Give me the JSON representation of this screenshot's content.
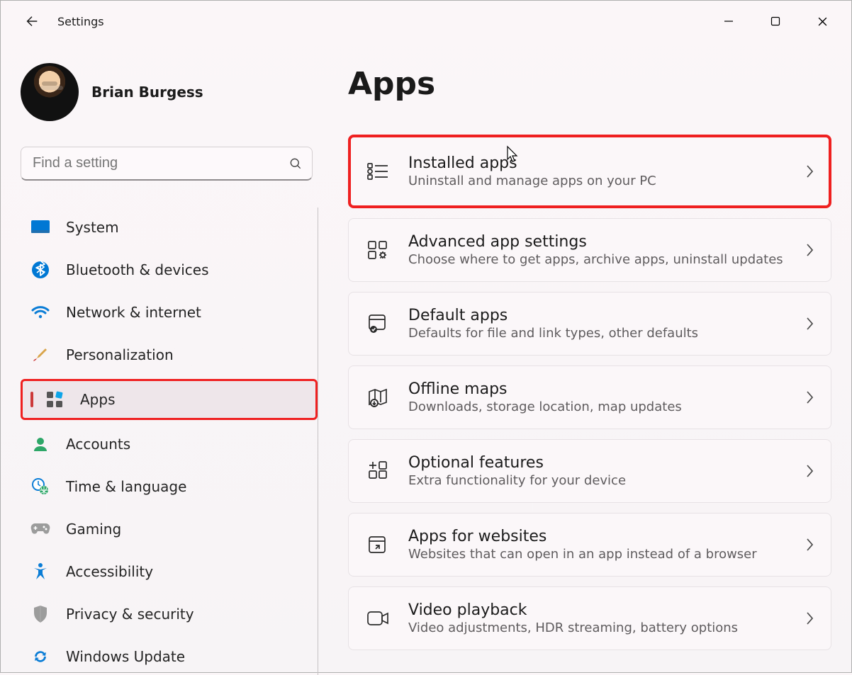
{
  "titlebar": {
    "app_title": "Settings"
  },
  "profile": {
    "username": "Brian Burgess"
  },
  "search": {
    "placeholder": "Find a setting"
  },
  "sidebar": {
    "items": [
      {
        "label": "System"
      },
      {
        "label": "Bluetooth & devices"
      },
      {
        "label": "Network & internet"
      },
      {
        "label": "Personalization"
      },
      {
        "label": "Apps"
      },
      {
        "label": "Accounts"
      },
      {
        "label": "Time & language"
      },
      {
        "label": "Gaming"
      },
      {
        "label": "Accessibility"
      },
      {
        "label": "Privacy & security"
      },
      {
        "label": "Windows Update"
      }
    ]
  },
  "main": {
    "page_title": "Apps",
    "cards": [
      {
        "title": "Installed apps",
        "desc": "Uninstall and manage apps on your PC"
      },
      {
        "title": "Advanced app settings",
        "desc": "Choose where to get apps, archive apps, uninstall updates"
      },
      {
        "title": "Default apps",
        "desc": "Defaults for file and link types, other defaults"
      },
      {
        "title": "Offline maps",
        "desc": "Downloads, storage location, map updates"
      },
      {
        "title": "Optional features",
        "desc": "Extra functionality for your device"
      },
      {
        "title": "Apps for websites",
        "desc": "Websites that can open in an app instead of a browser"
      },
      {
        "title": "Video playback",
        "desc": "Video adjustments, HDR streaming, battery options"
      }
    ]
  }
}
